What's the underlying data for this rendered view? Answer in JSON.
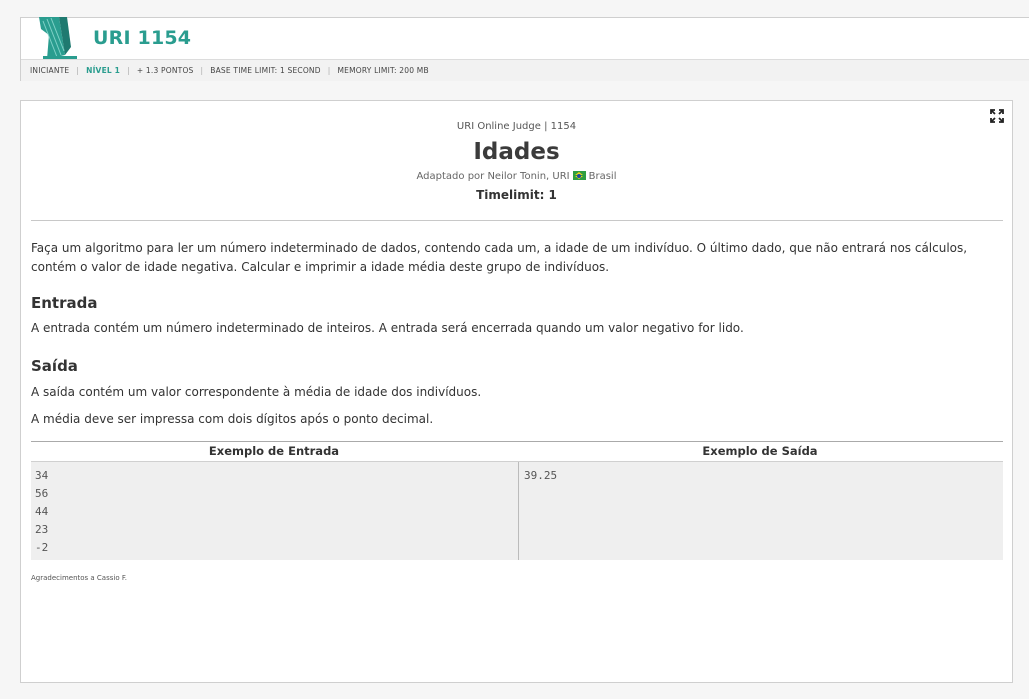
{
  "header": {
    "problem_code": "URI 1154",
    "meta": [
      "INICIANTE",
      "NÍVEL 1",
      "+ 1.3 PONTOS",
      "BASE TIME LIMIT: 1 SECOND",
      "MEMORY LIMIT: 200 MB"
    ],
    "accent_color": "#2a9d8f"
  },
  "problem": {
    "judge_line": "URI Online Judge | 1154",
    "title": "Idades",
    "author_prefix": "Adaptado por Neilor Tonin, URI",
    "country": "Brasil",
    "timelimit": "Timelimit: 1",
    "description": "Faça um algoritmo para ler um número indeterminado de dados, contendo cada um, a idade de um indivíduo. O último dado, que não entrará nos cálculos, contém o valor de idade negativa. Calcular e imprimir a idade média deste grupo de indivíduos.",
    "entrada_heading": "Entrada",
    "entrada_text": "A entrada contém um número indeterminado de inteiros. A entrada será encerrada quando um valor negativo for lido.",
    "saida_heading": "Saída",
    "saida_text_1": "A saída contém um valor correspondente à média de idade dos indivíduos.",
    "saida_text_2": "A média deve ser impressa com dois dígitos após o ponto decimal.",
    "examples": {
      "input_header": "Exemplo de Entrada",
      "output_header": "Exemplo de Saída",
      "input_lines": [
        "34",
        "56",
        "44",
        "23",
        "-2"
      ],
      "output_lines": [
        "39.25"
      ]
    },
    "thanks": "Agradecimentos a Cassio F."
  },
  "icons": {
    "expand": "expand-icon",
    "logo": "category-logo-icon",
    "flag": "brazil-flag-icon"
  }
}
